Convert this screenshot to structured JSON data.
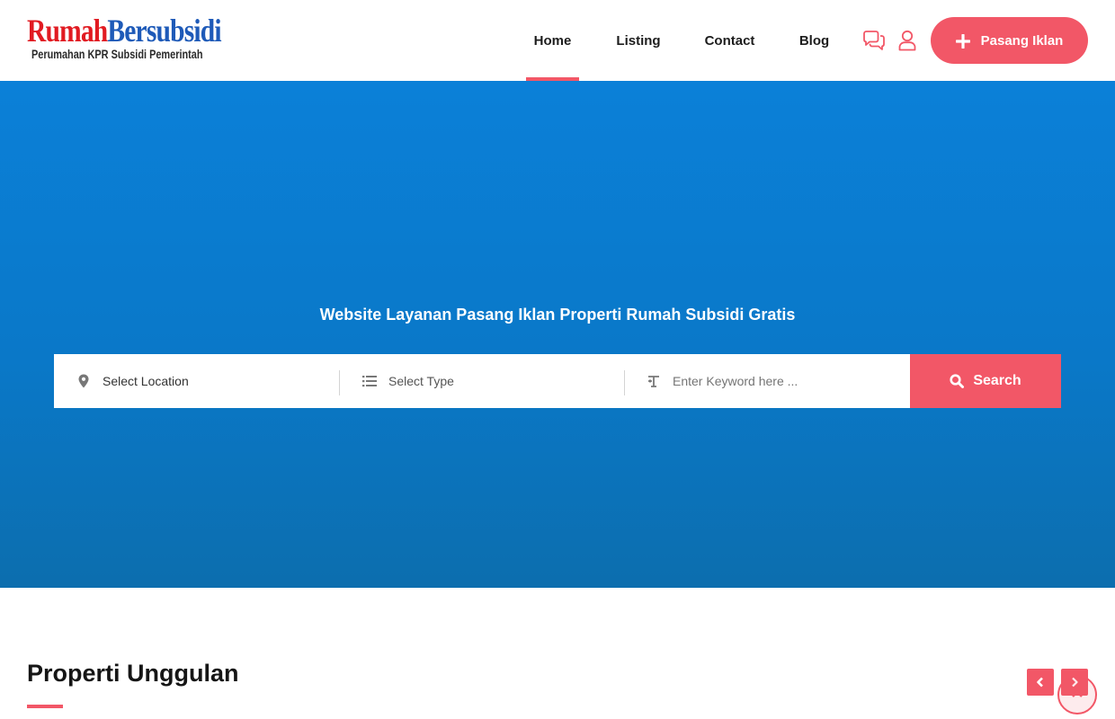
{
  "brand": {
    "logo_part1": "Rumah",
    "logo_part2": "Bersubsidi",
    "tagline": "Perumahan KPR Subsidi Pemerintah"
  },
  "nav": {
    "items": [
      {
        "label": "Home",
        "active": true
      },
      {
        "label": "Listing",
        "active": false
      },
      {
        "label": "Contact",
        "active": false
      },
      {
        "label": "Blog",
        "active": false
      }
    ],
    "icons": [
      "chat-icon",
      "user-icon"
    ],
    "cta_label": "Pasang Iklan"
  },
  "hero": {
    "title": "Website Layanan Pasang Iklan Properti Rumah Subsidi Gratis"
  },
  "search": {
    "location_placeholder": "Select Location",
    "type_placeholder": "Select Type",
    "keyword_placeholder": "Enter Keyword here ...",
    "button_label": "Search"
  },
  "section": {
    "title": "Properti Unggulan"
  },
  "colors": {
    "accent": "#f25767",
    "hero_blue": "#0b80d8",
    "logo_red": "#e11b22",
    "logo_blue": "#1e5ab8"
  }
}
